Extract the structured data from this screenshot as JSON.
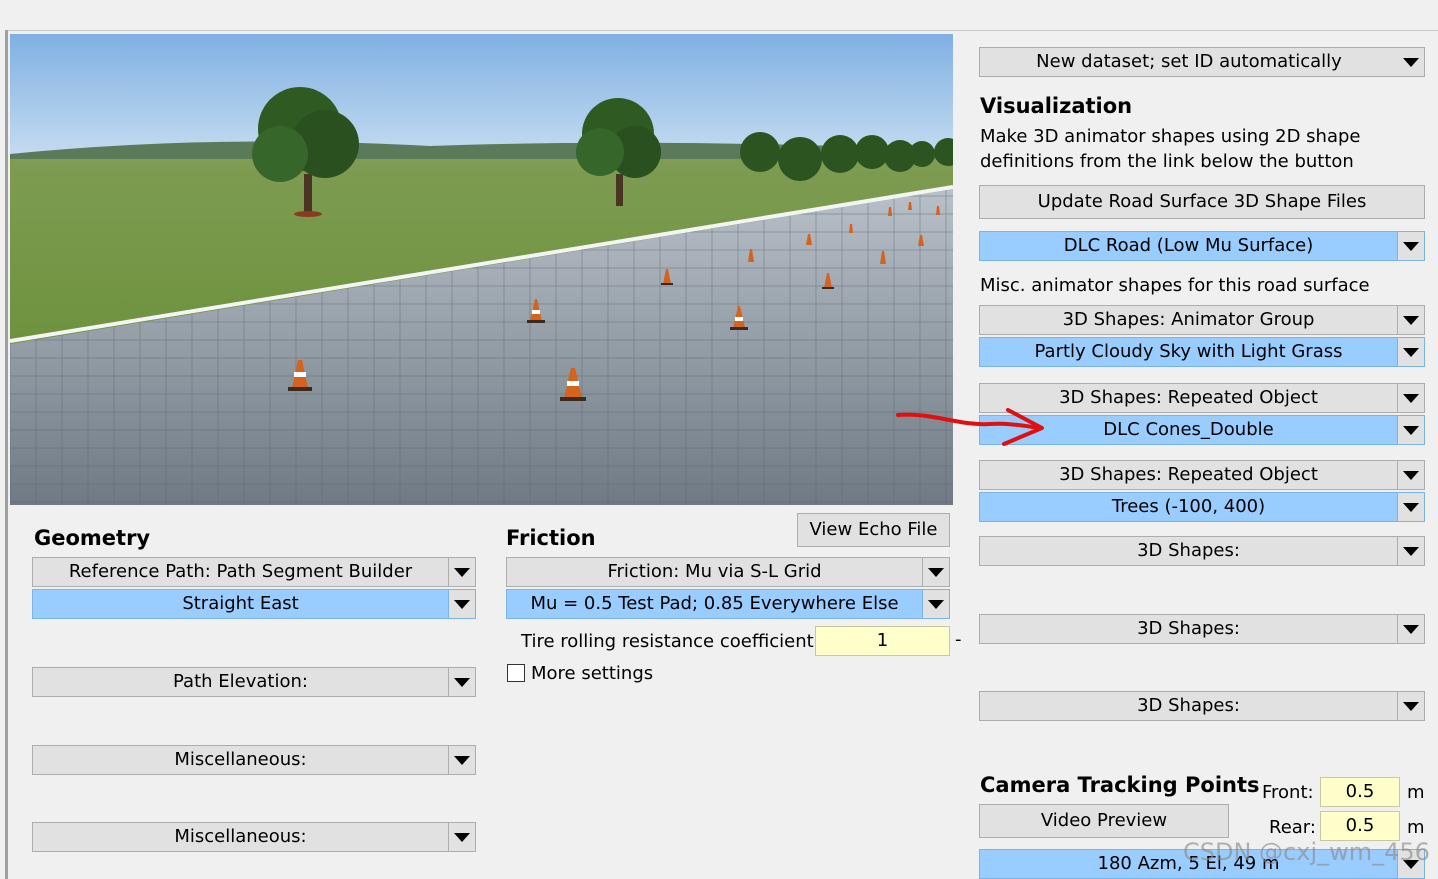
{
  "colors": {
    "dropdown_selected": "#99ccff",
    "input_yellow": "#ffffcc",
    "arrow_red": "#e01010"
  },
  "visualization": {
    "dataset": "New dataset; set ID automatically",
    "heading": "Visualization",
    "desc1": "Make 3D animator shapes using 2D shape",
    "desc2": "definitions from the link below the button",
    "update_button": "Update Road Surface 3D Shape Files",
    "road_shape": "DLC Road (Low Mu Surface)",
    "misc_label": "Misc. animator shapes for this road surface",
    "slots": [
      {
        "category": "3D Shapes: Animator Group",
        "dataset": "Partly Cloudy Sky with Light Grass"
      },
      {
        "category": "3D Shapes: Repeated Object",
        "dataset": "DLC Cones_Double"
      },
      {
        "category": "3D Shapes: Repeated Object",
        "dataset": "Trees (-100, 400)"
      },
      {
        "category": "3D Shapes:"
      },
      {
        "category": "3D Shapes:"
      },
      {
        "category": "3D Shapes:"
      }
    ]
  },
  "camera": {
    "heading": "Camera Tracking Points",
    "video_button": "Video Preview",
    "front_label": "Front:",
    "front_value": "0.5",
    "front_unit": "m",
    "rear_label": "Rear:",
    "rear_value": "0.5",
    "rear_unit": "m",
    "view": "180 Azm, 5 El, 49 m"
  },
  "geometry": {
    "heading": "Geometry",
    "path_category": "Reference Path: Path Segment Builder",
    "path_dataset": "Straight East",
    "elevation": "Path Elevation:",
    "misc1": "Miscellaneous:",
    "misc2": "Miscellaneous:"
  },
  "friction": {
    "heading": "Friction",
    "echo_button": "View Echo File",
    "category": "Friction: Mu via S-L Grid",
    "dataset": "Mu = 0.5 Test Pad; 0.85 Everywhere Else",
    "trr_label": "Tire rolling resistance coefficient:",
    "trr_value": "1",
    "trr_unit": "-",
    "more_settings": "More settings"
  },
  "watermark": "CSDN @cxj_wm_456"
}
